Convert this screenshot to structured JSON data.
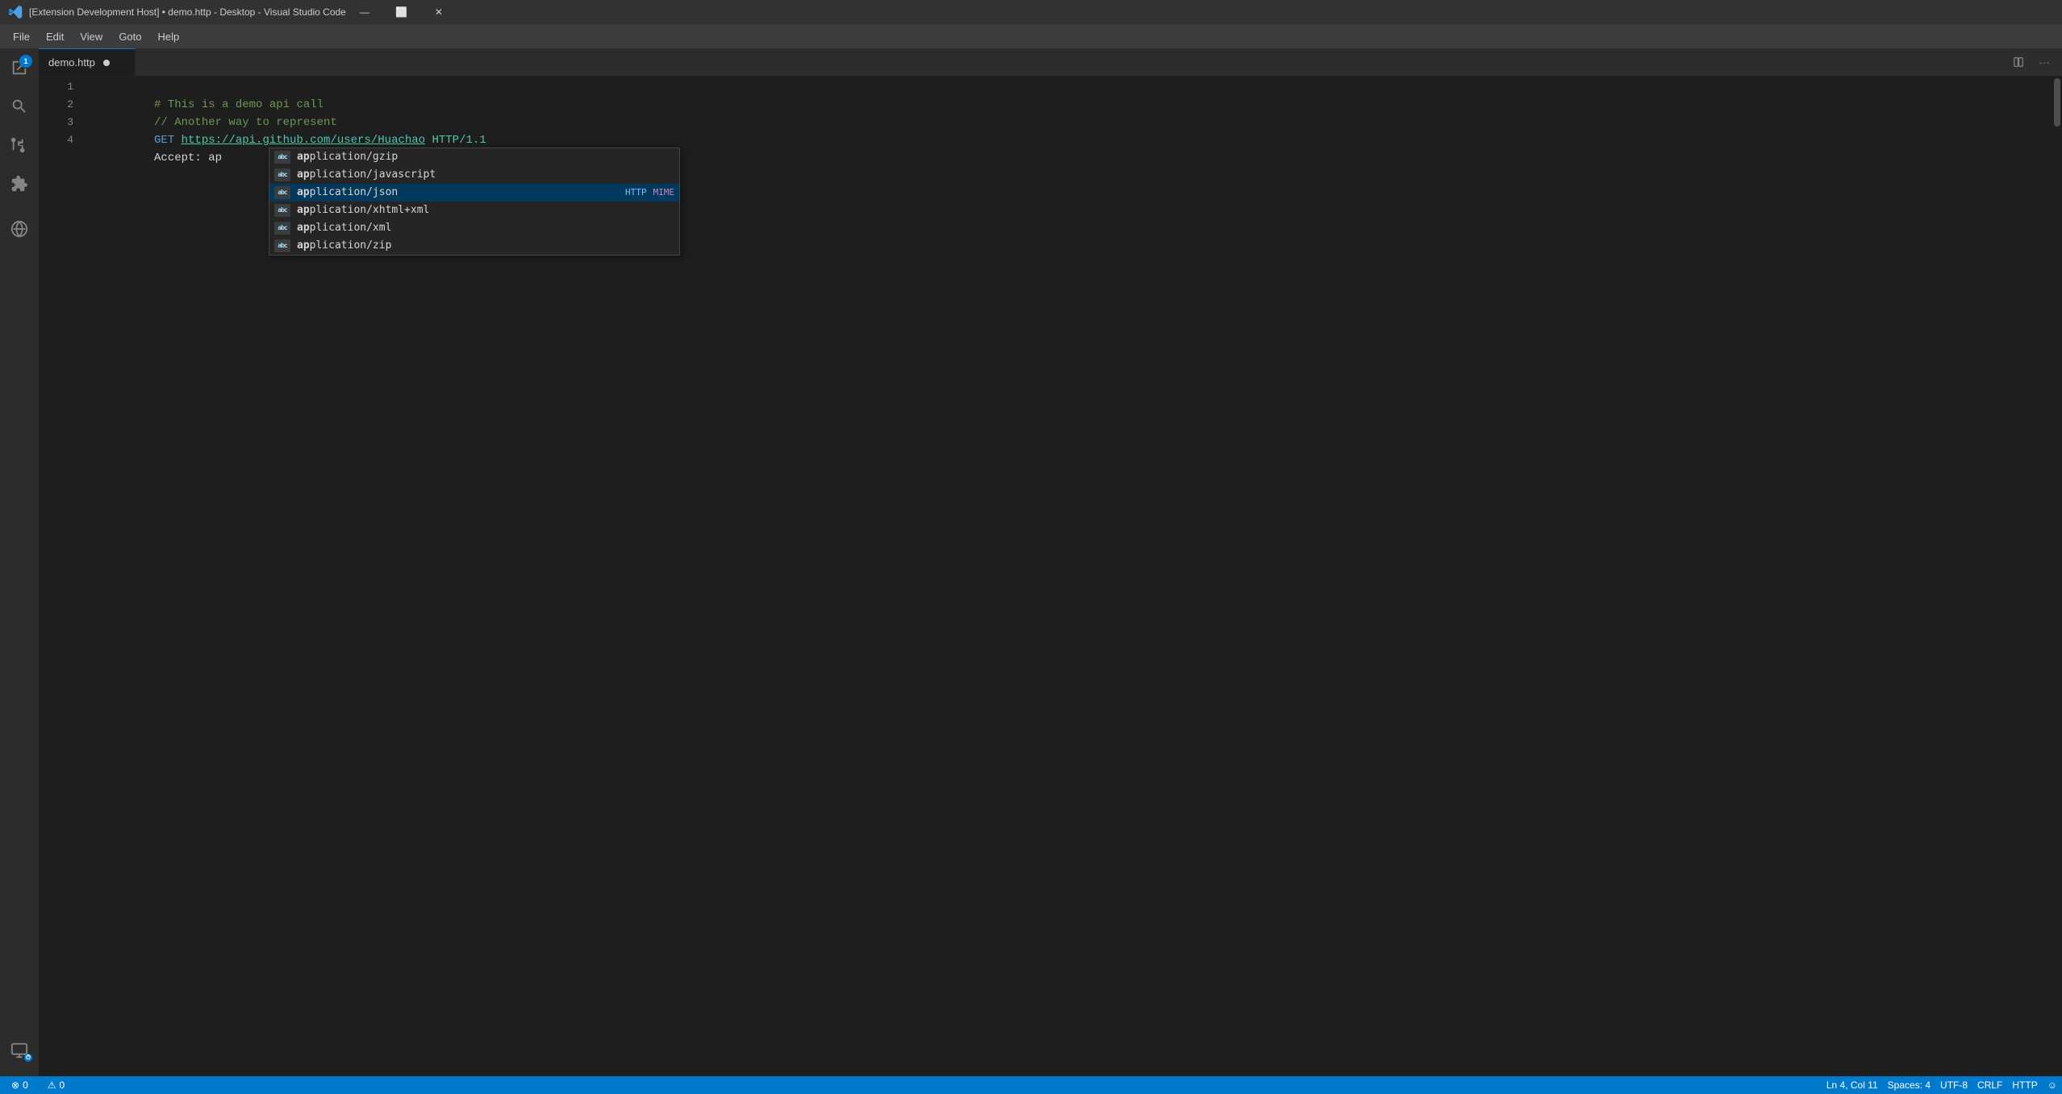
{
  "window": {
    "title": "[Extension Development Host] • demo.http - Desktop - Visual Studio Code",
    "icon": "vscode-icon"
  },
  "title_bar": {
    "minimize_label": "—",
    "maximize_label": "⬜",
    "close_label": "✕"
  },
  "menu_bar": {
    "items": [
      {
        "id": "file",
        "label": "File"
      },
      {
        "id": "edit",
        "label": "Edit"
      },
      {
        "id": "view",
        "label": "View"
      },
      {
        "id": "goto",
        "label": "Goto"
      },
      {
        "id": "help",
        "label": "Help"
      }
    ]
  },
  "activity_bar": {
    "icons": [
      {
        "id": "explorer",
        "symbol": "⎘",
        "active": false,
        "badge": "1"
      },
      {
        "id": "search",
        "symbol": "🔍",
        "active": false
      },
      {
        "id": "source-control",
        "symbol": "⎇",
        "active": false
      },
      {
        "id": "extensions",
        "symbol": "⊞",
        "active": false
      },
      {
        "id": "remote",
        "symbol": "⊗",
        "active": false
      }
    ],
    "bottom_icons": [
      {
        "id": "remote-explorer",
        "symbol": "□"
      },
      {
        "id": "accounts",
        "symbol": "⊙"
      }
    ]
  },
  "tab_bar": {
    "tabs": [
      {
        "id": "demo-http",
        "label": "demo.http",
        "modified": true,
        "active": true
      }
    ],
    "action_buttons": [
      {
        "id": "split",
        "symbol": "⧉"
      },
      {
        "id": "more",
        "symbol": "···"
      }
    ]
  },
  "editor": {
    "lines": [
      {
        "number": 1,
        "content_parts": [
          {
            "text": "# This is a demo api call",
            "class": "c-comment"
          }
        ]
      },
      {
        "number": 2,
        "content_parts": [
          {
            "text": "// Another way to represent",
            "class": "c-comment"
          }
        ]
      },
      {
        "number": 3,
        "content_parts": [
          {
            "text": "GET ",
            "class": "c-keyword"
          },
          {
            "text": "https://api.github.com/users/Huachao",
            "class": "c-url"
          },
          {
            "text": " HTTP/1.1",
            "class": "c-http"
          }
        ]
      },
      {
        "number": 4,
        "content_parts": [
          {
            "text": "Accept: ap",
            "class": "c-header-val"
          }
        ]
      }
    ]
  },
  "autocomplete": {
    "items": [
      {
        "icon": "abc",
        "text": "application/gzip",
        "type": "",
        "selected": false,
        "match_prefix": "ap"
      },
      {
        "icon": "abc",
        "text": "application/javascript",
        "type": "",
        "selected": false,
        "match_prefix": "ap"
      },
      {
        "icon": "abc",
        "text": "application/json",
        "type": "HTTP MIME",
        "selected": true,
        "match_prefix": "ap"
      },
      {
        "icon": "abc",
        "text": "application/xhtml+xml",
        "type": "",
        "selected": false,
        "match_prefix": "ap"
      },
      {
        "icon": "abc",
        "text": "application/xml",
        "type": "",
        "selected": false,
        "match_prefix": "ap"
      },
      {
        "icon": "abc",
        "text": "application/zip",
        "type": "",
        "selected": false,
        "match_prefix": "ap"
      }
    ],
    "type_color_http": "#75beff",
    "type_color_mime": "#c586c0"
  },
  "status_bar": {
    "left_items": [
      {
        "id": "errors",
        "text": "⊗ 0"
      },
      {
        "id": "warnings",
        "text": "⚠ 0"
      }
    ],
    "right_items": [
      {
        "id": "position",
        "text": "Ln 4, Col 11"
      },
      {
        "id": "spaces",
        "text": "Spaces: 4"
      },
      {
        "id": "encoding",
        "text": "UTF-8"
      },
      {
        "id": "eol",
        "text": "CRLF"
      },
      {
        "id": "language",
        "text": "HTTP"
      },
      {
        "id": "feedback",
        "text": "☺"
      }
    ]
  }
}
